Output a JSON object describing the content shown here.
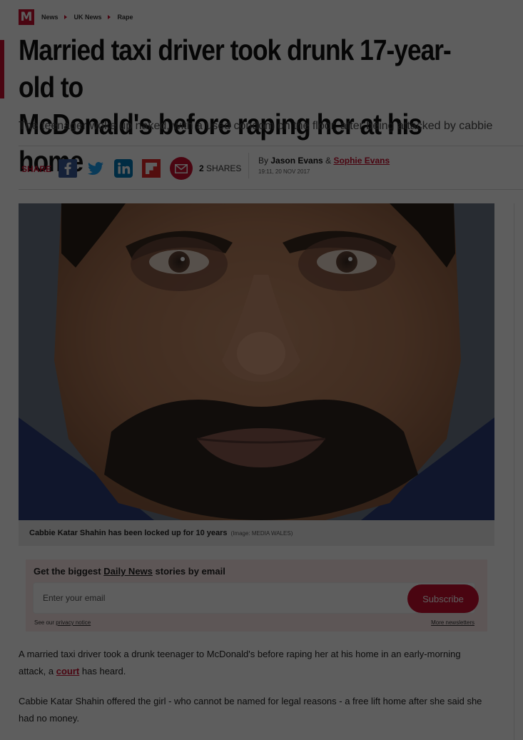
{
  "breadcrumb": {
    "logo": "M",
    "items": [
      "News",
      "UK News",
      "Rape"
    ]
  },
  "article": {
    "headline": "Married taxi driver took drunk 17-year-old to McDonald's before raping her at his home",
    "headline_line1": "Married taxi driver took drunk 17-year-old to",
    "headline_line2": "McDonald's before raping her at his home",
    "standfirst": "The teenager woke up naked, with a used condom on the floor, after being attacked by cabbie"
  },
  "share": {
    "label": "SHARE",
    "count": "2",
    "count_label": "SHARES",
    "icons": [
      "facebook-icon",
      "twitter-icon",
      "linkedin-icon",
      "flipboard-icon",
      "email-icon"
    ]
  },
  "byline": {
    "prefix": "By",
    "author1": "Jason Evans",
    "connector": "&",
    "author2": "Sophie Evans",
    "date": "19:11, 20 NOV 2017"
  },
  "photo": {
    "caption": "Cabbie Katar Shahin has been locked up for 10 years",
    "credit": "(Image: MEDIA WALES)"
  },
  "newsletter": {
    "title_prefix": "Get the biggest",
    "title_link": "Daily News",
    "title_suffix": "stories by email",
    "placeholder": "Enter your email",
    "button": "Subscribe",
    "privacy_prefix": "See our",
    "privacy_link": "privacy notice",
    "more": "More newsletters"
  },
  "body": {
    "p1_before": "A married taxi driver took a drunk teenager to McDonald's before raping her at his home in an early-morning attack, a",
    "p1_link": "court",
    "p1_after": "has heard.",
    "p2": "Cabbie Katar Shahin offered the girl - who cannot be named for legal reasons - a free lift home after she said she had no money."
  },
  "colors": {
    "brand": "#c8102e",
    "overlay": "rgba(0,0,0,0.63)"
  }
}
